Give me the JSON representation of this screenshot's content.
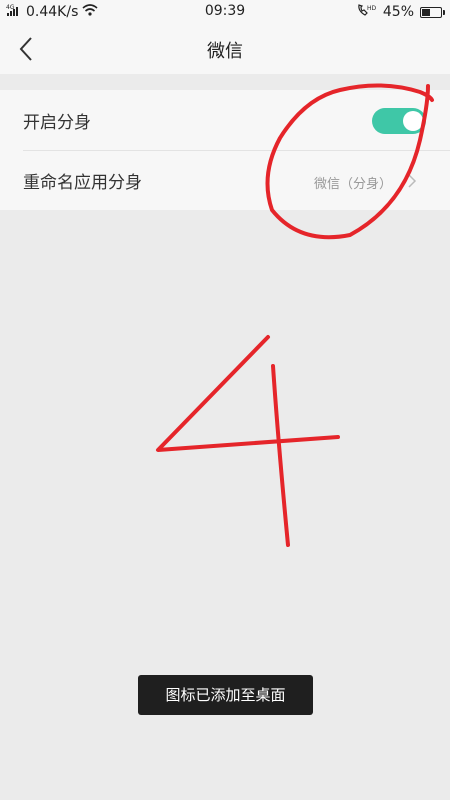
{
  "status_bar": {
    "network": "0.44K/s",
    "network_type": "4G",
    "time": "09:39",
    "battery_percent": "45%",
    "battery_level": 0.45,
    "icons": [
      "signal-icon",
      "wifi-icon",
      "hd-call-icon",
      "battery-icon"
    ]
  },
  "nav": {
    "title": "微信",
    "back_icon": "back-arrow-icon"
  },
  "settings": {
    "enable_clone_label": "开启分身",
    "enable_clone_on": true,
    "rename_label": "重命名应用分身",
    "rename_value": "微信（分身）"
  },
  "toast": {
    "message": "图标已添加至桌面"
  },
  "colors": {
    "toggle_on": "#3fc7a7",
    "annotation": "#e5252a",
    "background": "#ebebeb"
  }
}
